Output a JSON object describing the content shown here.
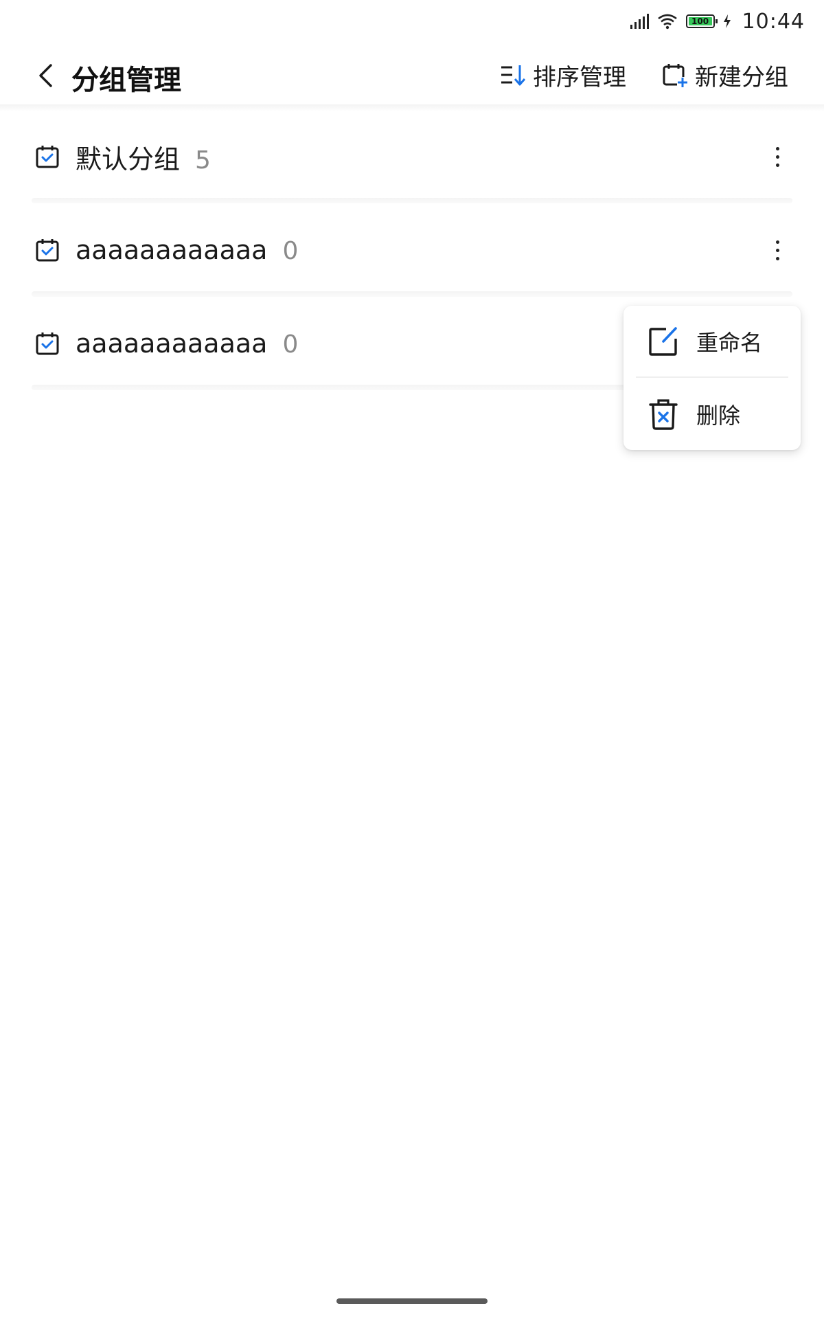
{
  "status_bar": {
    "time": "10:44",
    "battery_level": "100",
    "icons": [
      "signal-icon",
      "wifi-icon",
      "battery-icon",
      "charging-icon"
    ]
  },
  "header": {
    "title": "分组管理",
    "sort_label": "排序管理",
    "new_group_label": "新建分组",
    "icons": [
      "back-arrow-icon",
      "sort-icon",
      "new-group-icon"
    ]
  },
  "groups": [
    {
      "name": "默认分组",
      "count": "5"
    },
    {
      "name": "aaaaaaaaaaaa",
      "count": "0"
    },
    {
      "name": "aaaaaaaaaaaa",
      "count": "0"
    }
  ],
  "popup_menu": {
    "rename_label": "重命名",
    "delete_label": "删除",
    "icons": [
      "edit-icon",
      "trash-icon"
    ]
  },
  "colors": {
    "accent": "#1a73e8",
    "text": "#1a1a1a",
    "count_text": "#8a8a8a",
    "battery": "#35c759"
  }
}
